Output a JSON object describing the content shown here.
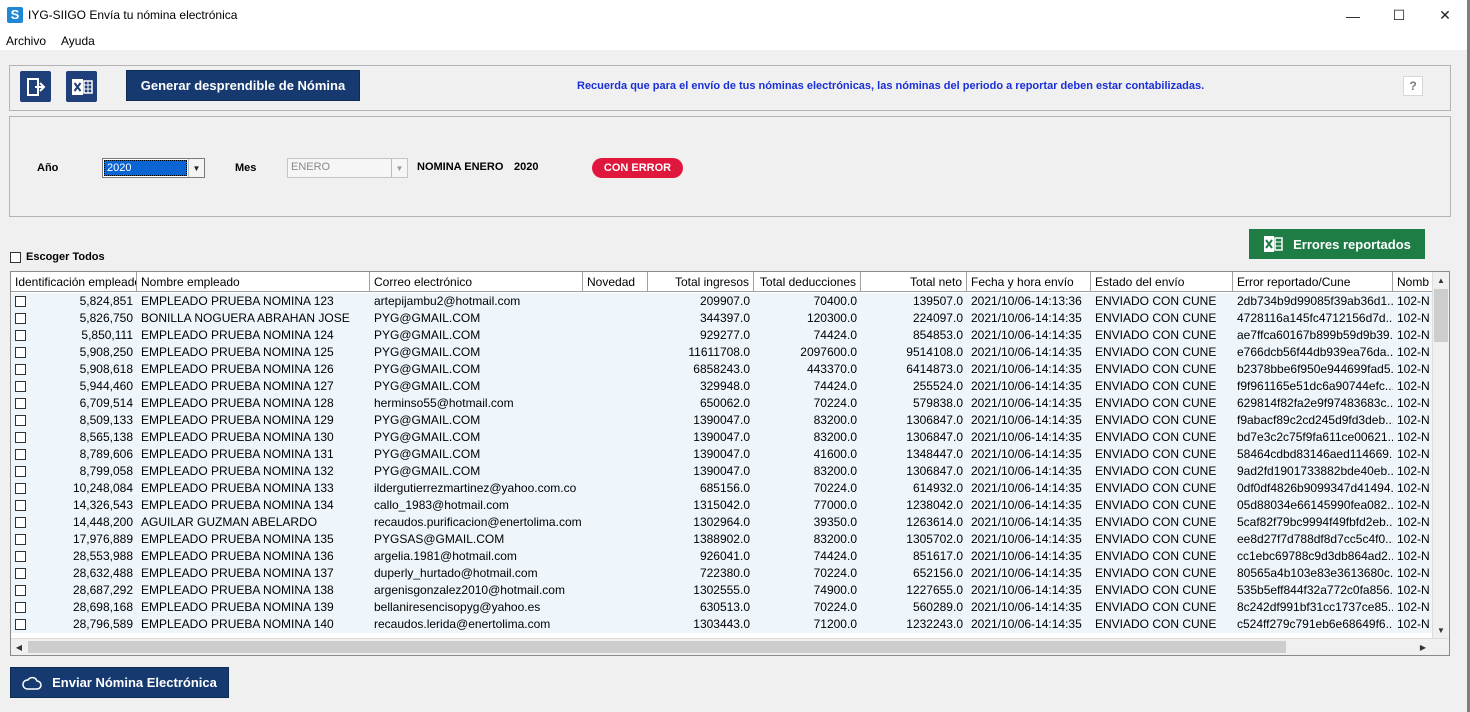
{
  "window": {
    "app_icon": "S",
    "title": "IYG-SIIGO Envía tu nómina electrónica",
    "minimize_glyph": "—",
    "maximize_glyph": "☐",
    "close_glyph": "✕"
  },
  "menu": {
    "items": [
      "Archivo",
      "Ayuda"
    ]
  },
  "toolbar": {
    "generar_label": "Generar desprendible de Nómina",
    "notice": "Recuerda que para el envío de tus nóminas electrónicas, las nóminas del periodo a reportar deben estar contabilizadas.",
    "help_label": "?"
  },
  "filters": {
    "anio_label": "Año",
    "anio_value": "2020",
    "mes_label": "Mes",
    "mes_value": "ENERO",
    "nomina_label": "NOMINA ENERO",
    "nomina_year": "2020",
    "status_badge": "CON ERROR",
    "status_color": "#e0173c"
  },
  "selection": {
    "escoger_todos_label": "Escoger Todos"
  },
  "errores_button": {
    "label": "Errores reportados",
    "icon": "excel-icon",
    "color": "#1e7c45"
  },
  "table": {
    "columns": [
      "Identificación empleado",
      "Nombre empleado",
      "Correo electrónico",
      "Novedad",
      "Total ingresos",
      "Total deducciones",
      "Total neto",
      "Fecha y hora envío",
      "Estado del envío",
      "Error reportado/Cune",
      "Nomb"
    ],
    "rows": [
      [
        "5,824,851",
        "EMPLEADO PRUEBA NOMINA 123",
        "artepijambu2@hotmail.com",
        "",
        "209907.0",
        "70400.0",
        "139507.0",
        "2021/10/06-14:13:36",
        "ENVIADO CON CUNE",
        "2db734b9d99085f39ab36d1...",
        "102-N"
      ],
      [
        "5,826,750",
        "BONILLA NOGUERA ABRAHAN JOSE",
        "PYG@GMAIL.COM",
        "",
        "344397.0",
        "120300.0",
        "224097.0",
        "2021/10/06-14:14:35",
        "ENVIADO CON CUNE",
        "4728116a145fc4712156d7d...",
        "102-N"
      ],
      [
        "5,850,111",
        "EMPLEADO PRUEBA NOMINA 124",
        "PYG@GMAIL.COM",
        "",
        "929277.0",
        "74424.0",
        "854853.0",
        "2021/10/06-14:14:35",
        "ENVIADO CON CUNE",
        "ae7ffca60167b899b59d9b39...",
        "102-N"
      ],
      [
        "5,908,250",
        "EMPLEADO PRUEBA NOMINA 125",
        "PYG@GMAIL.COM",
        "",
        "11611708.0",
        "2097600.0",
        "9514108.0",
        "2021/10/06-14:14:35",
        "ENVIADO CON CUNE",
        "e766dcb56f44db939ea76da...",
        "102-N"
      ],
      [
        "5,908,618",
        "EMPLEADO PRUEBA NOMINA 126",
        "PYG@GMAIL.COM",
        "",
        "6858243.0",
        "443370.0",
        "6414873.0",
        "2021/10/06-14:14:35",
        "ENVIADO CON CUNE",
        "b2378bbe6f950e944699fad5...",
        "102-N"
      ],
      [
        "5,944,460",
        "EMPLEADO PRUEBA NOMINA 127",
        "PYG@GMAIL.COM",
        "",
        "329948.0",
        "74424.0",
        "255524.0",
        "2021/10/06-14:14:35",
        "ENVIADO CON CUNE",
        "f9f961165e51dc6a90744efc...",
        "102-N"
      ],
      [
        "6,709,514",
        "EMPLEADO PRUEBA NOMINA 128",
        "herminso55@hotmail.com",
        "",
        "650062.0",
        "70224.0",
        "579838.0",
        "2021/10/06-14:14:35",
        "ENVIADO CON CUNE",
        "629814f82fa2e9f97483683c...",
        "102-N"
      ],
      [
        "8,509,133",
        "EMPLEADO PRUEBA NOMINA 129",
        "PYG@GMAIL.COM",
        "",
        "1390047.0",
        "83200.0",
        "1306847.0",
        "2021/10/06-14:14:35",
        "ENVIADO CON CUNE",
        "f9abacf89c2cd245d9fd3deb...",
        "102-N"
      ],
      [
        "8,565,138",
        "EMPLEADO PRUEBA NOMINA 130",
        "PYG@GMAIL.COM",
        "",
        "1390047.0",
        "83200.0",
        "1306847.0",
        "2021/10/06-14:14:35",
        "ENVIADO CON CUNE",
        "bd7e3c2c75f9fa611ce00621...",
        "102-N"
      ],
      [
        "8,789,606",
        "EMPLEADO PRUEBA NOMINA 131",
        "PYG@GMAIL.COM",
        "",
        "1390047.0",
        "41600.0",
        "1348447.0",
        "2021/10/06-14:14:35",
        "ENVIADO CON CUNE",
        "58464cdbd83146aed114669...",
        "102-N"
      ],
      [
        "8,799,058",
        "EMPLEADO PRUEBA NOMINA 132",
        "PYG@GMAIL.COM",
        "",
        "1390047.0",
        "83200.0",
        "1306847.0",
        "2021/10/06-14:14:35",
        "ENVIADO CON CUNE",
        "9ad2fd1901733882bde40eb...",
        "102-N"
      ],
      [
        "10,248,084",
        "EMPLEADO PRUEBA NOMINA 133",
        "ildergutierrezmartinez@yahoo.com.co",
        "",
        "685156.0",
        "70224.0",
        "614932.0",
        "2021/10/06-14:14:35",
        "ENVIADO CON CUNE",
        "0df0df4826b9099347d41494...",
        "102-N"
      ],
      [
        "14,326,543",
        "EMPLEADO PRUEBA NOMINA 134",
        "callo_1983@hotmail.com",
        "",
        "1315042.0",
        "77000.0",
        "1238042.0",
        "2021/10/06-14:14:35",
        "ENVIADO CON CUNE",
        "05d88034e66145990fea082...",
        "102-N"
      ],
      [
        "14,448,200",
        "AGUILAR GUZMAN ABELARDO",
        "recaudos.purificacion@enertolima.com",
        "",
        "1302964.0",
        "39350.0",
        "1263614.0",
        "2021/10/06-14:14:35",
        "ENVIADO CON CUNE",
        "5caf82f79bc9994f49fbfd2eb...",
        "102-N"
      ],
      [
        "17,976,889",
        "EMPLEADO PRUEBA NOMINA 135",
        "PYGSAS@GMAIL.COM",
        "",
        "1388902.0",
        "83200.0",
        "1305702.0",
        "2021/10/06-14:14:35",
        "ENVIADO CON CUNE",
        "ee8d27f7d788df8d7cc5c4f0...",
        "102-N"
      ],
      [
        "28,553,988",
        "EMPLEADO PRUEBA NOMINA 136",
        "argelia.1981@hotmail.com",
        "",
        "926041.0",
        "74424.0",
        "851617.0",
        "2021/10/06-14:14:35",
        "ENVIADO CON CUNE",
        "cc1ebc69788c9d3db864ad2...",
        "102-N"
      ],
      [
        "28,632,488",
        "EMPLEADO PRUEBA NOMINA 137",
        "duperly_hurtado@hotmail.com",
        "",
        "722380.0",
        "70224.0",
        "652156.0",
        "2021/10/06-14:14:35",
        "ENVIADO CON CUNE",
        "80565a4b103e83e3613680c...",
        "102-N"
      ],
      [
        "28,687,292",
        "EMPLEADO PRUEBA NOMINA 138",
        "argenisgonzalez2010@hotmail.com",
        "",
        "1302555.0",
        "74900.0",
        "1227655.0",
        "2021/10/06-14:14:35",
        "ENVIADO CON CUNE",
        "535b5eff844f32a772c0fa856...",
        "102-N"
      ],
      [
        "28,698,168",
        "EMPLEADO PRUEBA NOMINA 139",
        "bellaniresencisopyg@yahoo.es",
        "",
        "630513.0",
        "70224.0",
        "560289.0",
        "2021/10/06-14:14:35",
        "ENVIADO CON CUNE",
        "8c242df991bf31cc1737ce85...",
        "102-N"
      ],
      [
        "28,796,589",
        "EMPLEADO PRUEBA NOMINA 140",
        "recaudos.lerida@enertolima.com",
        "",
        "1303443.0",
        "71200.0",
        "1232243.0",
        "2021/10/06-14:14:35",
        "ENVIADO CON CUNE",
        "c524ff279c791eb6e68649f6...",
        "102-N"
      ]
    ]
  },
  "footer": {
    "enviar_label": "Enviar Nómina Electrónica",
    "enviar_icon": "cloud-icon"
  }
}
